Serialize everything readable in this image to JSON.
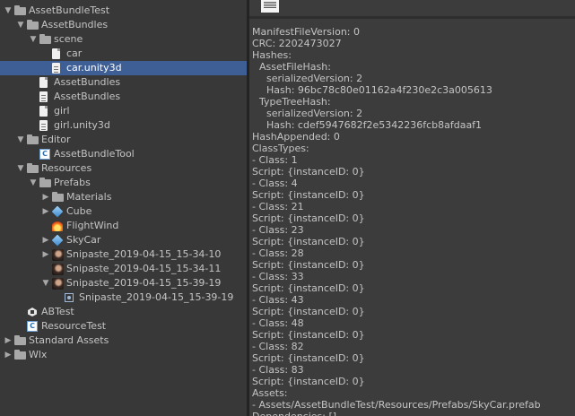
{
  "project_tree": [
    {
      "label": "AssetBundleTest",
      "depth": 0,
      "fold": "open",
      "icon": "folder-icon",
      "name": "tree-item-assetbundletest"
    },
    {
      "label": "AssetBundles",
      "depth": 1,
      "fold": "open",
      "icon": "folder-icon",
      "name": "tree-item-assetbundles-folder"
    },
    {
      "label": "scene",
      "depth": 2,
      "fold": "open",
      "icon": "folder-icon",
      "name": "tree-item-scene"
    },
    {
      "label": "car",
      "depth": 3,
      "fold": "",
      "icon": "file-icon",
      "name": "tree-item-car"
    },
    {
      "label": "car.unity3d",
      "depth": 3,
      "fold": "",
      "icon": "text-file-icon",
      "selected": true,
      "name": "tree-item-car-unity3d"
    },
    {
      "label": "AssetBundles",
      "depth": 2,
      "fold": "",
      "icon": "file-icon",
      "name": "tree-item-assetbundles-file"
    },
    {
      "label": "AssetBundles",
      "depth": 2,
      "fold": "",
      "icon": "text-file-icon",
      "name": "tree-item-assetbundles-manifest"
    },
    {
      "label": "girl",
      "depth": 2,
      "fold": "",
      "icon": "file-icon",
      "name": "tree-item-girl"
    },
    {
      "label": "girl.unity3d",
      "depth": 2,
      "fold": "",
      "icon": "text-file-icon",
      "name": "tree-item-girl-unity3d"
    },
    {
      "label": "Editor",
      "depth": 1,
      "fold": "open",
      "icon": "folder-icon",
      "name": "tree-item-editor"
    },
    {
      "label": "AssetBundleTool",
      "depth": 2,
      "fold": "",
      "icon": "csharp-script-icon",
      "name": "tree-item-assetbundletool"
    },
    {
      "label": "Resources",
      "depth": 1,
      "fold": "open",
      "icon": "folder-icon",
      "name": "tree-item-resources"
    },
    {
      "label": "Prefabs",
      "depth": 2,
      "fold": "open",
      "icon": "folder-icon",
      "name": "tree-item-prefabs"
    },
    {
      "label": "Materials",
      "depth": 3,
      "fold": "closed",
      "icon": "folder-icon",
      "name": "tree-item-materials"
    },
    {
      "label": "Cube",
      "depth": 3,
      "fold": "closed",
      "icon": "prefab-cube-icon",
      "name": "tree-item-cube"
    },
    {
      "label": "FlightWind",
      "depth": 3,
      "fold": "",
      "icon": "particle-fire-icon",
      "name": "tree-item-flightwind"
    },
    {
      "label": "SkyCar",
      "depth": 3,
      "fold": "closed",
      "icon": "prefab-cube-icon",
      "name": "tree-item-skycar"
    },
    {
      "label": "Snipaste_2019-04-15_15-34-10",
      "depth": 3,
      "fold": "closed",
      "icon": "image-thumbnail-icon",
      "name": "tree-item-snipaste-1"
    },
    {
      "label": "Snipaste_2019-04-15_15-34-11",
      "depth": 3,
      "fold": "",
      "icon": "image-thumbnail-icon",
      "name": "tree-item-snipaste-2"
    },
    {
      "label": "Snipaste_2019-04-15_15-39-19",
      "depth": 3,
      "fold": "open",
      "icon": "image-thumbnail-icon",
      "name": "tree-item-snipaste-3"
    },
    {
      "label": "Snipaste_2019-04-15_15-39-19",
      "depth": 4,
      "fold": "",
      "icon": "sprite-icon",
      "name": "tree-item-snipaste-3-sprite"
    },
    {
      "label": "ABTest",
      "depth": 1,
      "fold": "",
      "icon": "unity-scene-icon",
      "name": "tree-item-abtest"
    },
    {
      "label": "ResourceTest",
      "depth": 1,
      "fold": "",
      "icon": "csharp-script-icon",
      "name": "tree-item-resourcetest"
    },
    {
      "label": "Standard Assets",
      "depth": 0,
      "fold": "closed",
      "icon": "folder-icon",
      "name": "tree-item-standard-assets"
    },
    {
      "label": "Wlx",
      "depth": 0,
      "fold": "closed",
      "icon": "folder-icon",
      "name": "tree-item-wlx"
    }
  ],
  "manifest_lines": [
    {
      "indent": 0,
      "text": "ManifestFileVersion: 0"
    },
    {
      "indent": 0,
      "text": "CRC: 2202473027"
    },
    {
      "indent": 0,
      "text": "Hashes:"
    },
    {
      "indent": 1,
      "text": "AssetFileHash:"
    },
    {
      "indent": 2,
      "text": "serializedVersion: 2"
    },
    {
      "indent": 2,
      "text": "Hash: 96bc78c80e01162a4f230e2c3a005613"
    },
    {
      "indent": 1,
      "text": "TypeTreeHash:"
    },
    {
      "indent": 2,
      "text": "serializedVersion: 2"
    },
    {
      "indent": 2,
      "text": "Hash: cdef5947682f2e5342236fcb8afdaaf1"
    },
    {
      "indent": 0,
      "text": "HashAppended: 0"
    },
    {
      "indent": 0,
      "text": "ClassTypes:"
    },
    {
      "indent": 0,
      "text": "- Class: 1"
    },
    {
      "indent": 0,
      "text": "  Script: {instanceID: 0}"
    },
    {
      "indent": 0,
      "text": "- Class: 4"
    },
    {
      "indent": 0,
      "text": "  Script: {instanceID: 0}"
    },
    {
      "indent": 0,
      "text": "- Class: 21"
    },
    {
      "indent": 0,
      "text": "  Script: {instanceID: 0}"
    },
    {
      "indent": 0,
      "text": "- Class: 23"
    },
    {
      "indent": 0,
      "text": "  Script: {instanceID: 0}"
    },
    {
      "indent": 0,
      "text": "- Class: 28"
    },
    {
      "indent": 0,
      "text": "  Script: {instanceID: 0}"
    },
    {
      "indent": 0,
      "text": "- Class: 33"
    },
    {
      "indent": 0,
      "text": "  Script: {instanceID: 0}"
    },
    {
      "indent": 0,
      "text": "- Class: 43"
    },
    {
      "indent": 0,
      "text": "  Script: {instanceID: 0}"
    },
    {
      "indent": 0,
      "text": "- Class: 48"
    },
    {
      "indent": 0,
      "text": "  Script: {instanceID: 0}"
    },
    {
      "indent": 0,
      "text": "- Class: 82"
    },
    {
      "indent": 0,
      "text": "  Script: {instanceID: 0}"
    },
    {
      "indent": 0,
      "text": "- Class: 83"
    },
    {
      "indent": 0,
      "text": "  Script: {instanceID: 0}"
    },
    {
      "indent": 0,
      "text": "Assets:"
    },
    {
      "indent": 0,
      "text": "- Assets/AssetBundleTest/Resources/Prefabs/SkyCar.prefab"
    },
    {
      "indent": 0,
      "text": "Dependencies: []"
    }
  ],
  "colors": {
    "selection": "#3e5f96",
    "panel": "#383838",
    "inspector": "#3c3c3c",
    "text": "#c4c4c4"
  }
}
